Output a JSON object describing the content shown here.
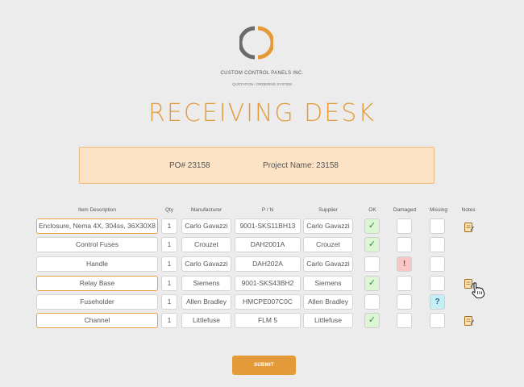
{
  "brand": {
    "company": "CUSTOM CONTROL PANELS INC.",
    "subtitle": "QUOTATION / ORDERING SYSTEM",
    "accent": "#e59a3a",
    "logo_gray": "#6b6b6b"
  },
  "title": "RECEIVING DESK",
  "po": {
    "number": "PO# 23158",
    "project": "Project Name: 23158"
  },
  "headers": {
    "description": "Item Description",
    "qty": "Qty",
    "manufacturer": "Manufacturer",
    "pn": "P / N",
    "supplier": "Supplier",
    "ok": "OK",
    "damaged": "Damaged",
    "missing": "Missing",
    "notes": "Notes"
  },
  "rows": [
    {
      "description": "Enclosure, Nema 4X, 304ss, 36X30X8",
      "qty": "1",
      "manufacturer": "Carlo Gavazzi",
      "pn": "9001-SKS11BH13",
      "supplier": "Carlo Gavazzi",
      "ok": "✓",
      "damaged": "",
      "missing": ""
    },
    {
      "description": "Control Fuses",
      "qty": "1",
      "manufacturer": "Crouzet",
      "pn": "DAH2001A",
      "supplier": "Crouzet",
      "ok": "✓",
      "damaged": "",
      "missing": ""
    },
    {
      "description": "Handle",
      "qty": "1",
      "manufacturer": "Carlo Gavazzi",
      "pn": "DAH202A",
      "supplier": "Carlo Gavazzi",
      "ok": "",
      "damaged": "!",
      "missing": ""
    },
    {
      "description": "Relay Base",
      "qty": "1",
      "manufacturer": "Siemens",
      "pn": "9001-SKS43BH2",
      "supplier": "Siemens",
      "ok": "✓",
      "damaged": "",
      "missing": ""
    },
    {
      "description": "Fuseholder",
      "qty": "1",
      "manufacturer": "Allen Bradley",
      "pn": "HMCPE007C0C",
      "supplier": "Allen Bradley",
      "ok": "",
      "damaged": "",
      "missing": "?"
    },
    {
      "description": "Channel",
      "qty": "1",
      "manufacturer": "Littlefuse",
      "pn": "FLM 5",
      "supplier": "Littlefuse",
      "ok": "✓",
      "damaged": "",
      "missing": ""
    }
  ],
  "submit_label": "SUBMIT"
}
